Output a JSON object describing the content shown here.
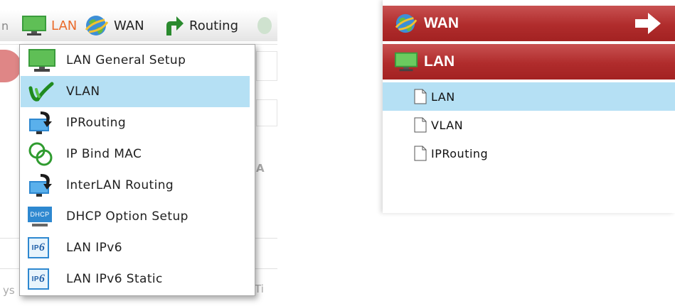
{
  "top_nav": {
    "cut_label": "n",
    "lan_label": "LAN",
    "wan_label": "WAN",
    "routing_label": "Routing"
  },
  "background_fragments": {
    "a": "A",
    "b": "ys",
    "c": "Ti"
  },
  "lan_dropdown": {
    "items": [
      {
        "label": "LAN General Setup",
        "icon": "monitor-icon"
      },
      {
        "label": "VLAN",
        "icon": "vlan-icon",
        "selected": true
      },
      {
        "label": "IPRouting",
        "icon": "ip-routing-icon"
      },
      {
        "label": "IP Bind MAC",
        "icon": "bind-mac-icon"
      },
      {
        "label": "InterLAN Routing",
        "icon": "interlan-routing-icon"
      },
      {
        "label": "DHCP Option Setup",
        "icon": "dhcp-icon"
      },
      {
        "label": "LAN IPv6",
        "icon": "ipv6-icon"
      },
      {
        "label": "LAN IPv6 Static",
        "icon": "ipv6-icon"
      }
    ],
    "dhcp_icon_text": "DHCP",
    "ipv6_icon_text": "IP"
  },
  "side_menu": {
    "wan_label": "WAN",
    "lan_label": "LAN",
    "sub_items": [
      {
        "label": "LAN",
        "selected": true
      },
      {
        "label": "VLAN"
      },
      {
        "label": "IPRouting"
      }
    ]
  },
  "colors": {
    "active_nav": "#ea6a2a",
    "selection": "#b5e0f4",
    "menu_red": "#b02c2c"
  }
}
